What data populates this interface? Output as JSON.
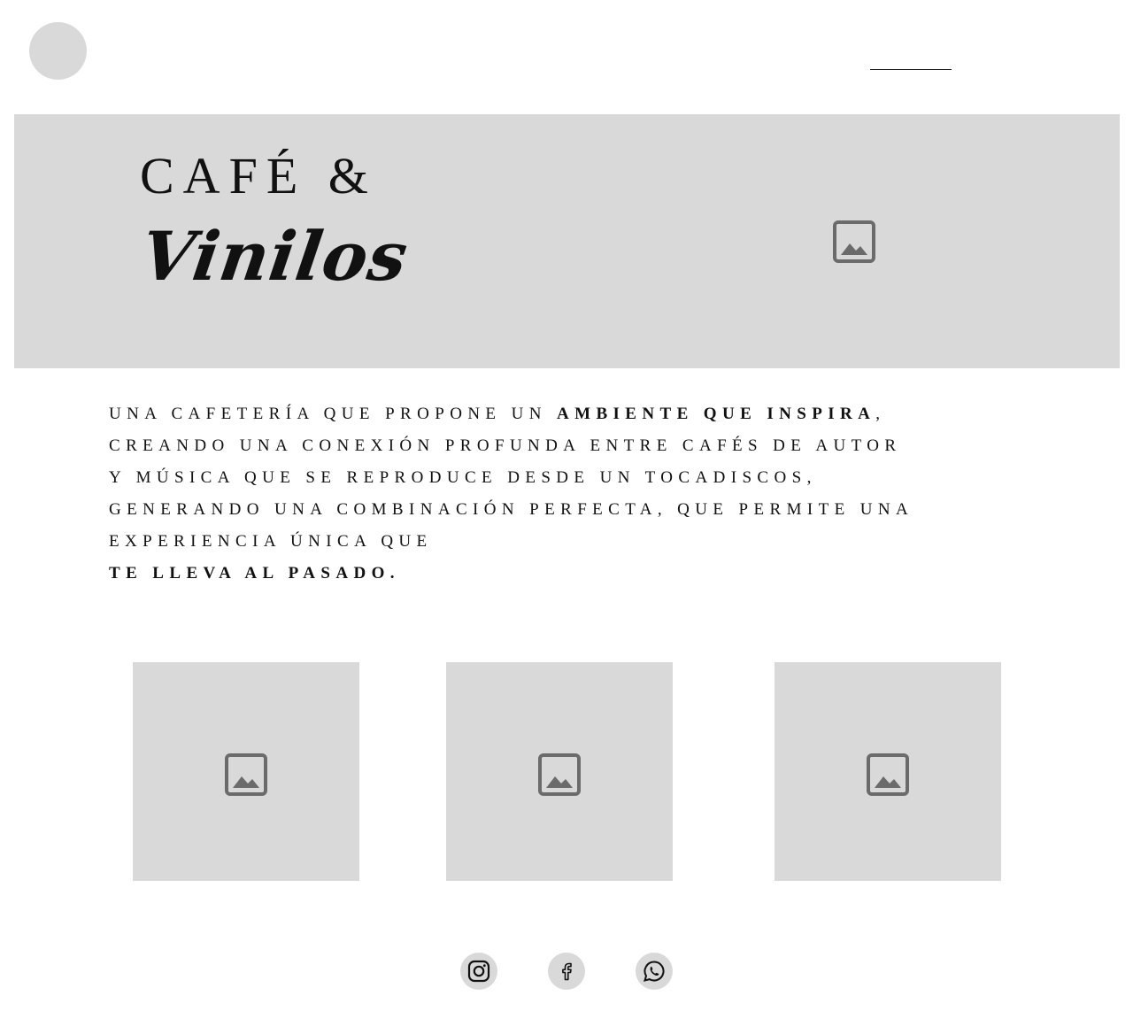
{
  "header": {
    "logo": "logo-placeholder",
    "nav_underline_text": ""
  },
  "hero": {
    "title_top": "CAFÉ &",
    "title_script": "Vinilos",
    "image_icon": "image-placeholder-icon"
  },
  "intro": {
    "line1_part1": "UNA CAFETERÍA QUE PROPONE UN ",
    "line1_bold": "AMBIENTE QUE INSPIRA",
    "line1_part2": ",",
    "line2": "CREANDO UNA CONEXIÓN PROFUNDA  ENTRE CAFÉS DE AUTOR",
    "line3": "Y MÚSICA QUE SE REPRODUCE DESDE  UN TOCADISCOS,",
    "line4": "GENERANDO UNA COMBINACIÓN PERFECTA, QUE PERMITE UNA",
    "line5": "EXPERIENCIA ÚNICA QUE",
    "line6_bold": "TE LLEVA AL  PASADO."
  },
  "gallery": {
    "items": [
      {
        "icon": "image-placeholder-icon"
      },
      {
        "icon": "image-placeholder-icon"
      },
      {
        "icon": "image-placeholder-icon"
      }
    ]
  },
  "social": {
    "items": [
      {
        "icon": "instagram-icon"
      },
      {
        "icon": "facebook-icon"
      },
      {
        "icon": "whatsapp-icon"
      }
    ]
  },
  "colors": {
    "placeholder_gray": "#d9d9d9",
    "icon_gray": "#6b6b6b",
    "text": "#111111"
  }
}
